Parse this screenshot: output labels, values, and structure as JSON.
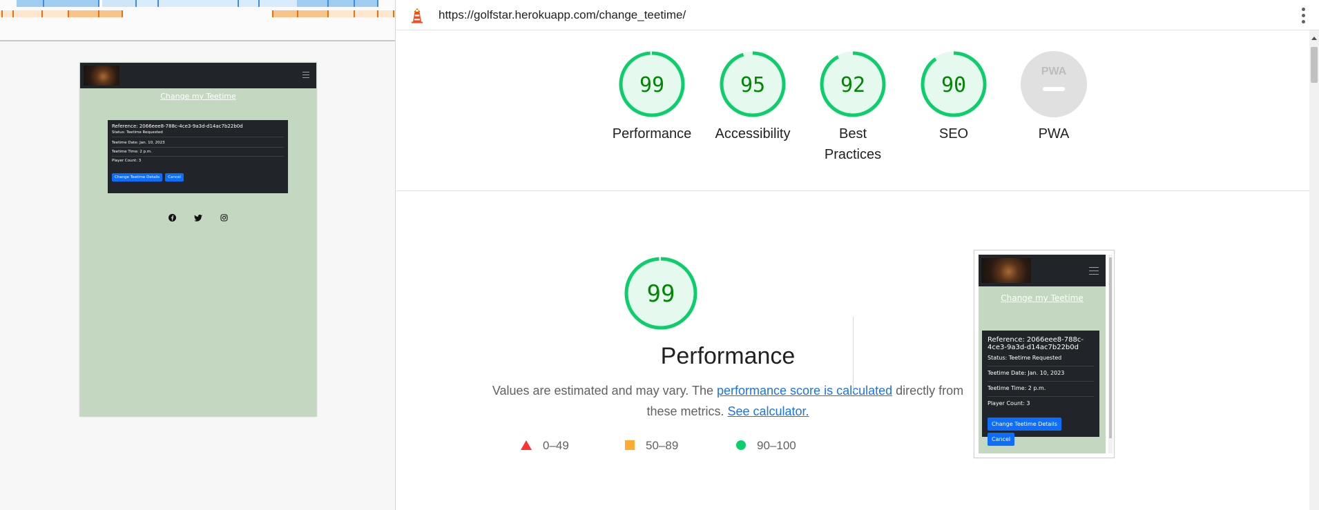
{
  "browser": {
    "url": "https://golfstar.herokuapp.com/change_teetime/"
  },
  "site": {
    "page_title": "Change my Teetime",
    "card": {
      "reference": "Reference: 2066eee8-788c-4ce3-9a3d-d14ac7b22b0d",
      "status": "Status: Teetime Requested",
      "date": "Teetime Date: Jan. 10, 2023",
      "time": "Teetime Time: 2 p.m.",
      "players": "Player Count: 3",
      "change_button": "Change Teetime Details",
      "cancel_button": "Cancel"
    },
    "social_icons": [
      "facebook-icon",
      "twitter-icon",
      "instagram-icon"
    ]
  },
  "lighthouse": {
    "scores": [
      {
        "label": "Performance",
        "score": 99
      },
      {
        "label": "Accessibility",
        "score": 95
      },
      {
        "label": "Best Practices",
        "score": 92
      },
      {
        "label": "SEO",
        "score": 90
      },
      {
        "label": "PWA",
        "score": null
      }
    ],
    "pwa_badge": "PWA",
    "performance": {
      "score": "99",
      "title": "Performance",
      "desc_pre": "Values are estimated and may vary. The ",
      "desc_link1": "performance score is calculated",
      "desc_mid": " directly from these metrics. ",
      "desc_link2": "See calculator."
    },
    "legend": [
      {
        "range": "0–49",
        "color": "#ff3333",
        "shape": "triangle"
      },
      {
        "range": "50–89",
        "color": "#ffaa33",
        "shape": "square"
      },
      {
        "range": "90–100",
        "color": "#0cce6b",
        "shape": "circle"
      }
    ]
  },
  "colors": {
    "pass_green": "#0cce6b",
    "pass_text": "#008800",
    "pass_fill": "#e6f9ef",
    "navbar": "#212529",
    "page_bg": "#c4d8c1",
    "button_blue": "#0d6efd",
    "link_blue": "#1a73e8"
  }
}
